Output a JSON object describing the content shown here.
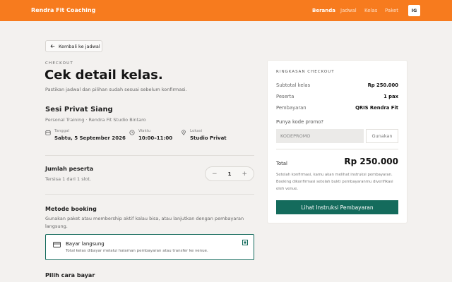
{
  "header": {
    "brand": "Rendra Fit Coaching",
    "nav": [
      "Beranda",
      "Jadwal",
      "Kelas",
      "Paket"
    ],
    "active_nav": "Beranda",
    "avatar_initials": "IG"
  },
  "back_label": "Kembali ke jadwal",
  "eyebrow": "CHECKOUT",
  "title": "Cek detail kelas.",
  "subtitle": "Pastikan jadwal dan pilihan sudah sesuai sebelum konfirmasi.",
  "session": {
    "name": "Sesi Privat Siang",
    "meta": "Personal Training · Rendra Fit Studio Bintaro",
    "date_label": "Tanggal",
    "date_value": "Sabtu, 5 September 2026",
    "time_label": "Waktu",
    "time_value": "10:00–11:00",
    "location_label": "Lokasi",
    "location_value": "Studio Privat"
  },
  "participants": {
    "title": "Jumlah peserta",
    "remaining": "Tersisa 1 dari 1 slot.",
    "minus": "−",
    "value": "1",
    "plus": "+"
  },
  "booking_method": {
    "title": "Metode booking",
    "description": "Gunakan paket atau membership aktif kalau bisa, atau lanjutkan dengan pembayaran langsung.",
    "option_title": "Bayar langsung",
    "option_desc": "Total kelas dibayar melalui halaman pembayaran atau transfer ke venue."
  },
  "pay_title": "Pilih cara bayar",
  "summary": {
    "eyebrow": "RINGKASAN CHECKOUT",
    "subtotal_label": "Subtotal kelas",
    "subtotal_value": "Rp 250.000",
    "participants_label": "Peserta",
    "participants_value": "1 pax",
    "payment_label": "Pembayaran",
    "payment_value": "QRIS Rendra Fit",
    "promo_question": "Punya kode promo?",
    "promo_placeholder": "KODEPROMO",
    "promo_button": "Gunakan",
    "total_label": "Total",
    "total_value": "Rp 250.000",
    "note": "Setelah konfirmasi, kamu akan melihat instruksi pembayaran. Booking dikonfirmasi setelah bukti pembayaranmu diverifikasi oleh venue.",
    "cta": "Lihat Instruksi Pembayaran"
  },
  "colors": {
    "accent": "#f77b1e",
    "primary": "#146b5c",
    "background": "#f3f1ef"
  }
}
